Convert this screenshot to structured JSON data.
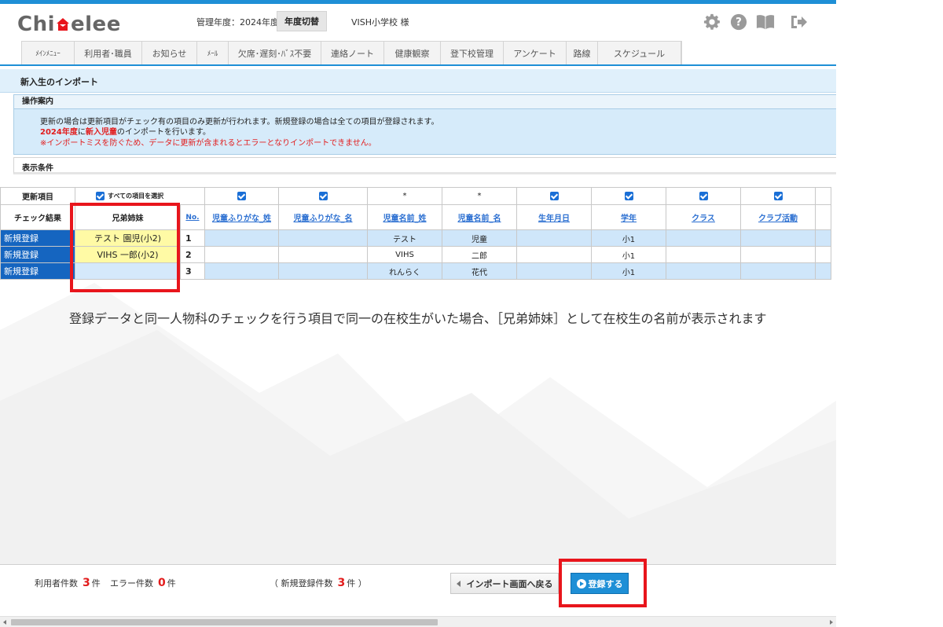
{
  "header": {
    "logo_text_left": "Chi",
    "logo_text_right": "elee",
    "fiscal_year_label": "管理年度：2024年度",
    "fiscal_year_button": "年度切替",
    "school_name": "VISH小学校 様"
  },
  "nav": {
    "items": [
      {
        "label": "ﾒｲﾝﾒﾆｭｰ"
      },
      {
        "label": "利用者･職員"
      },
      {
        "label": "お知らせ"
      },
      {
        "label": "ﾒｰﾙ"
      },
      {
        "label": "欠席･遅刻･ﾊﾞｽ不要"
      },
      {
        "label": "連絡ノート"
      },
      {
        "label": "健康観察"
      },
      {
        "label": "登下校管理"
      },
      {
        "label": "アンケート"
      },
      {
        "label": "路線"
      },
      {
        "label": "スケジュール"
      }
    ]
  },
  "page": {
    "title": "新入生のインポート"
  },
  "guide": {
    "title": "操作案内",
    "line1": "更新の場合は更新項目がチェック有の項目のみ更新が行われます。新規登録の場合は全ての項目が登録されます。",
    "line2_year": "2024年度",
    "line2_mid": "に",
    "line2_target": "新入児童",
    "line2_end": "のインポートを行います。",
    "line3": "※インポートミスを防ぐため、データに更新が含まれるとエラーとなりインポートできません。"
  },
  "conditions": {
    "title": "表示条件"
  },
  "table": {
    "update_items_label": "更新項目",
    "select_all_label": "すべての項目を選択",
    "col_check_result": "チェック結果",
    "col_siblings": "兄弟姉妹",
    "col_no": "No.",
    "columns": [
      {
        "label": "児童ふりがな_姓",
        "mark": "check"
      },
      {
        "label": "児童ふりがな_名",
        "mark": "check"
      },
      {
        "label": "児童名前_姓",
        "mark": "*"
      },
      {
        "label": "児童名前_名",
        "mark": "*"
      },
      {
        "label": "生年月日",
        "mark": "check"
      },
      {
        "label": "学年",
        "mark": "check"
      },
      {
        "label": "クラス",
        "mark": "check"
      },
      {
        "label": "クラブ活動",
        "mark": "check"
      }
    ],
    "rows": [
      {
        "result": "新規登録",
        "sibling": "テスト 園児(小2)",
        "no": "1",
        "cells": [
          "",
          "",
          "テスト",
          "児童",
          "",
          "小1",
          "",
          ""
        ]
      },
      {
        "result": "新規登録",
        "sibling": "VIHS 一郎(小2)",
        "no": "2",
        "cells": [
          "",
          "",
          "VIHS",
          "二郎",
          "",
          "小1",
          "",
          ""
        ]
      },
      {
        "result": "新規登録",
        "sibling": "",
        "no": "3",
        "cells": [
          "",
          "",
          "れんらく",
          "花代",
          "",
          "小1",
          "",
          ""
        ]
      }
    ]
  },
  "note": "登録データと同一人物科のチェックを行う項目で同一の在校生がいた場合、［兄弟姉妹］として在校生の名前が表示されます",
  "footer": {
    "users_label": "利用者件数",
    "users_count": "3",
    "users_unit": "件",
    "errors_label": "エラー件数",
    "errors_count": "0",
    "errors_unit": "件",
    "new_label": "（ 新規登録件数",
    "new_count": "3",
    "new_unit": "件 ）",
    "back_button": "インポート画面へ戻る",
    "register_button": "登録する"
  },
  "colors": {
    "accent": "#1e8fd6",
    "result_cell": "#1565c0",
    "sibling_highlight": "#fffaa5",
    "annotation_red": "#e8151c"
  }
}
